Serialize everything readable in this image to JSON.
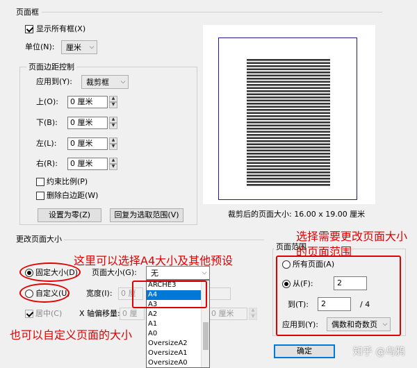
{
  "page_frame": {
    "title": "页面框",
    "show_all_boxes": {
      "label": "显示所有框(X)",
      "checked": true
    },
    "unit": {
      "label": "单位(N):",
      "value": "厘米"
    }
  },
  "margin_control": {
    "title": "页面边距控制",
    "apply_to": {
      "label": "应用到(Y):",
      "value": "裁剪框"
    },
    "fields": [
      {
        "label": "上(O):",
        "value": "0 厘米"
      },
      {
        "label": "下(B):",
        "value": "0 厘米"
      },
      {
        "label": "左(L):",
        "value": "0 厘米"
      },
      {
        "label": "右(R):",
        "value": "0 厘米"
      }
    ],
    "constrain": {
      "label": "约束比例(P)",
      "checked": false
    },
    "remove_white": {
      "label": "删除白边距(W)",
      "checked": false
    },
    "set_zero_button": "设置为零(Z)",
    "revert_button": "回复为选取范围(V)"
  },
  "preview": {
    "caption": "裁剪后的页面大小: 16.00 x 19.00 厘米"
  },
  "change_size": {
    "title": "更改页面大小",
    "fixed_size": {
      "label": "固定大小(D)",
      "selected": true
    },
    "custom": {
      "label": "自定义(U)",
      "selected": false
    },
    "page_size": {
      "label": "页面大小(G):",
      "value": "无"
    },
    "width_label": "宽度(I):",
    "width_value": "0 厘",
    "center": {
      "label": "居中(C)",
      "checked": true
    },
    "x_offset": {
      "label": "X 轴偏移量:",
      "value": "0 厘"
    },
    "y_value": "0 厘米",
    "size_options": [
      "ARCHE3",
      "A4",
      "A3",
      "A2",
      "A1",
      "A0",
      "OversizeA2",
      "OversizeA1",
      "OversizeA0"
    ],
    "highlighted_option": "A4"
  },
  "page_range": {
    "title": "页面范围",
    "all_pages": {
      "label": "所有页面(A)",
      "selected": false
    },
    "from": {
      "label": "从(F):",
      "value": "2",
      "selected": true
    },
    "to": {
      "label": "到(T):",
      "value": "2",
      "total": "/ 4"
    },
    "apply_to": {
      "label": "应用到(Y):",
      "value": "偶数和奇数页"
    }
  },
  "ok_button": "确定",
  "annotations": {
    "preset_note": "这里可以选择A4大小及其他预设",
    "custom_note": "也可以自定义页面的大小",
    "range_note_line1": "选择需要更改页面大小",
    "range_note_line2": "的页面范围"
  },
  "watermark": "知乎 @乌鸦",
  "colors": {
    "annotation": "#e00000",
    "highlight": "#0078d7"
  }
}
